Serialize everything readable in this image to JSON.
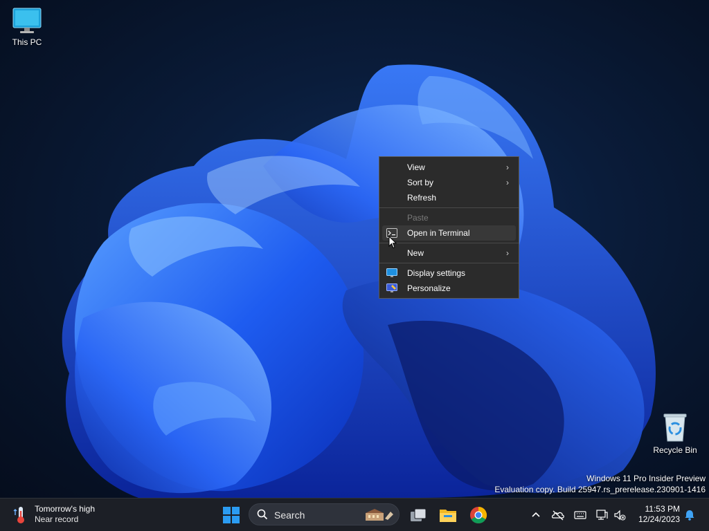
{
  "desktop": {
    "icons": [
      {
        "label": "This PC",
        "icon": "monitor-icon"
      },
      {
        "label": "Recycle Bin",
        "icon": "recycle-bin-icon"
      }
    ],
    "watermark": {
      "line1": "Windows 11 Pro Insider Preview",
      "line2": "Evaluation copy. Build 25947.rs_prerelease.230901-1416"
    }
  },
  "context_menu": {
    "items": [
      {
        "label": "View",
        "has_submenu": true
      },
      {
        "label": "Sort by",
        "has_submenu": true
      },
      {
        "label": "Refresh"
      },
      {
        "label": "Paste",
        "disabled": true
      },
      {
        "label": "Open in Terminal",
        "icon": "terminal-icon",
        "hovered": true
      },
      {
        "label": "New",
        "has_submenu": true
      },
      {
        "label": "Display settings",
        "icon": "display-settings-icon"
      },
      {
        "label": "Personalize",
        "icon": "personalize-icon"
      }
    ],
    "submenu_arrow": "›"
  },
  "taskbar": {
    "weather": {
      "title": "Tomorrow's high",
      "subtitle": "Near record",
      "icon": "thermometer-icon"
    },
    "search": {
      "label": "Search",
      "icon": "search-icon"
    },
    "apps": [
      {
        "name": "Task View",
        "icon": "task-view-icon"
      },
      {
        "name": "File Explorer",
        "icon": "folder-icon"
      },
      {
        "name": "Google Chrome",
        "icon": "chrome-icon"
      }
    ],
    "tray": {
      "time": "11:53 PM",
      "date": "12/24/2023"
    },
    "colors": {
      "accent": "#0078d4",
      "background": "#1c1f26"
    }
  }
}
